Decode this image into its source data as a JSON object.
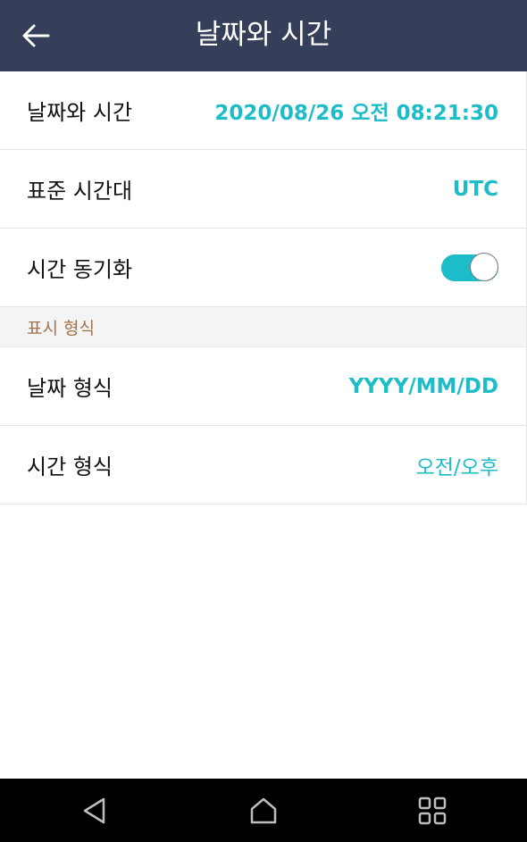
{
  "header": {
    "title": "날짜와 시간",
    "back_icon": "arrow-left-icon"
  },
  "settings": {
    "rows": [
      {
        "label": "날짜와 시간",
        "value": "2020/08/26 오전 08:21:30"
      },
      {
        "label": "표준 시간대",
        "value": "UTC"
      },
      {
        "label": "시간 동기화",
        "toggle_on": true
      }
    ],
    "display_section": {
      "title": "표시 형식",
      "rows": [
        {
          "label": "날짜 형식",
          "value": "YYYY/MM/DD"
        },
        {
          "label": "시간 형식",
          "value": "오전/오후"
        }
      ]
    }
  },
  "navbar": {
    "icons": [
      "back-triangle-icon",
      "home-icon",
      "recent-apps-icon"
    ]
  },
  "colors": {
    "header_bg": "#353f59",
    "accent": "#1cbcc8",
    "section_title": "#a0714a"
  }
}
